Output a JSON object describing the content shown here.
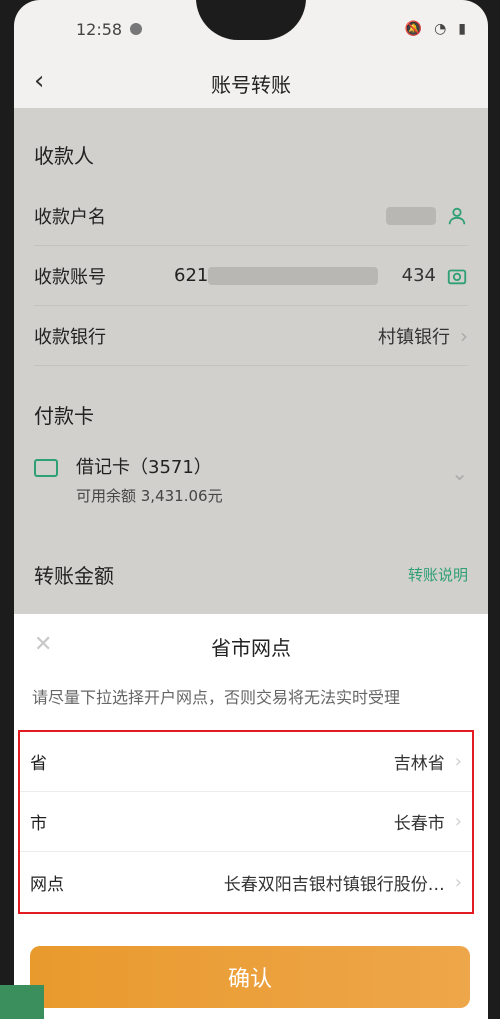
{
  "status_bar": {
    "time": "12:58"
  },
  "nav": {
    "back_icon": "chevron-left-icon",
    "title": "账号转账"
  },
  "payee": {
    "section_title": "收款人",
    "name_label": "收款户名",
    "account_label": "收款账号",
    "account_prefix": "621",
    "account_suffix": "434",
    "bank_label": "收款银行",
    "bank_value": "村镇银行"
  },
  "payment_card": {
    "section_title": "付款卡",
    "card_name": "借记卡（3571）",
    "balance": "可用余额 3,431.06元"
  },
  "transfer": {
    "amount_title": "转账金额",
    "help_link": "转账说明"
  },
  "sheet": {
    "title": "省市网点",
    "hint": "请尽量下拉选择开户网点，否则交易将无法实时受理",
    "rows": [
      {
        "label": "省",
        "value": "吉林省"
      },
      {
        "label": "市",
        "value": "长春市"
      },
      {
        "label": "网点",
        "value": "长春双阳吉银村镇银行股份…"
      }
    ],
    "confirm": "确认"
  },
  "colors": {
    "accent_green": "#2f9f76",
    "confirm_orange": "#e99a2d",
    "highlight_red": "#e31b23"
  }
}
